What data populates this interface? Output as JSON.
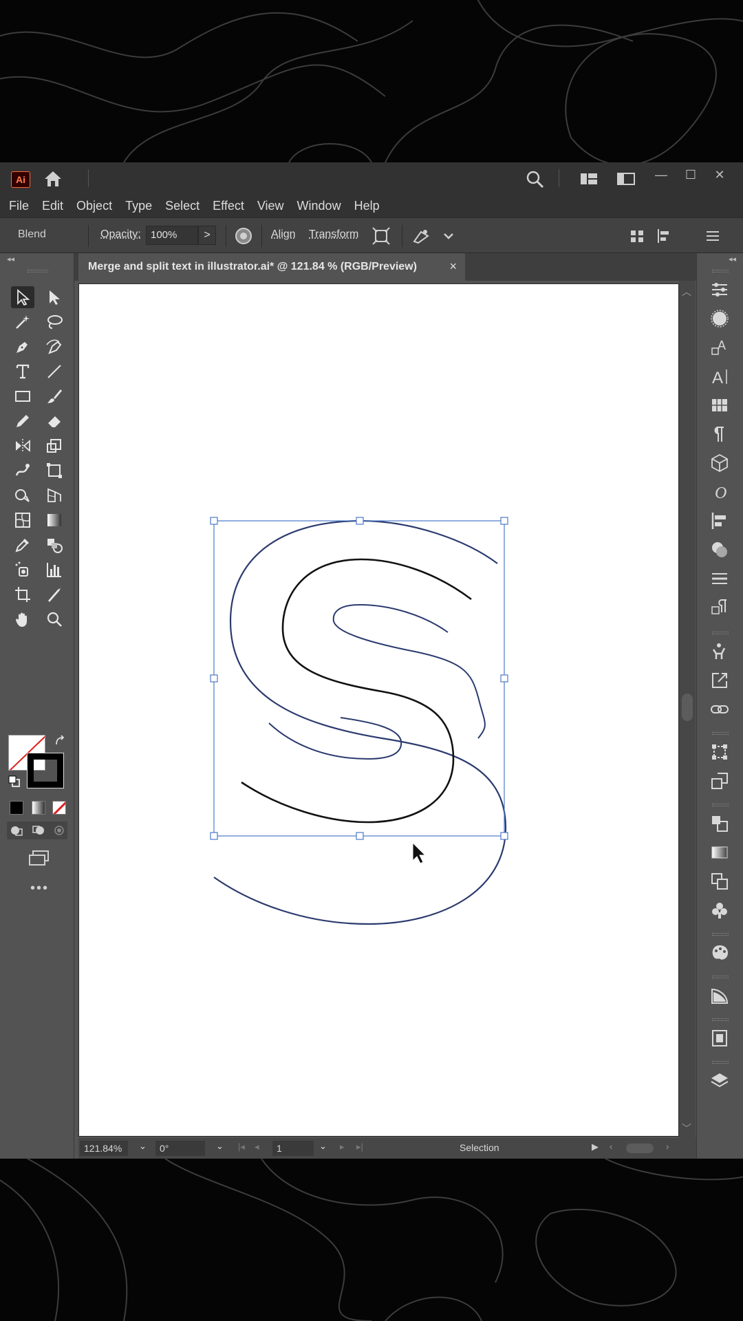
{
  "app": {
    "logo_text": "Ai",
    "document_tab_title": "Merge and split text in illustrator.ai* @ 121.84 % (RGB/Preview)",
    "close_glyph": "×"
  },
  "window_controls": {
    "minimize": "—",
    "maximize": "☐",
    "close": "✕"
  },
  "menu": [
    "File",
    "Edit",
    "Object",
    "Type",
    "Select",
    "Effect",
    "View",
    "Window",
    "Help"
  ],
  "control_bar": {
    "selection_type": "Blend",
    "opacity_label": "Opacity:",
    "opacity_value": "100%",
    "more_arrow": ">",
    "align_label": "Align",
    "transform_label": "Transform"
  },
  "status_bar": {
    "zoom": "121.84%",
    "rotation": "0°",
    "artboard": "1",
    "mode": "Selection"
  },
  "colors": {
    "ui_dark": "#323232",
    "panel": "#535353",
    "selection_blue": "#4a78c8",
    "path_navy": "#2b3a6e",
    "app_orange": "#ff7f50"
  },
  "icons": {
    "left_tools": [
      "selection-tool-icon",
      "direct-selection-tool-icon",
      "magic-wand-icon",
      "lasso-icon",
      "pen-tool-icon",
      "curvature-tool-icon",
      "type-tool-icon",
      "line-segment-icon",
      "rectangle-tool-icon",
      "paintbrush-icon",
      "pencil-icon",
      "eraser-icon",
      "reflect-icon",
      "scale-icon",
      "warp-icon",
      "free-transform-icon",
      "shape-builder-icon",
      "perspective-grid-icon",
      "mesh-icon",
      "gradient-icon",
      "eyedropper-icon",
      "blend-icon",
      "symbol-sprayer-icon",
      "column-graph-icon",
      "artboard-icon",
      "slice-icon",
      "hand-icon",
      "zoom-icon"
    ],
    "right_panels": [
      "properties-icon",
      "appearance-icon",
      "character-styles-icon",
      "character-icon",
      "glyphs-icon",
      "paragraph-icon",
      "3d-icon",
      "opentype-icon",
      "align-icon",
      "pathfinder-icon",
      "stroke-icon",
      "paragraph-styles-icon",
      "puppet-icon",
      "export-icon",
      "links-icon",
      "transform-icon",
      "asset-export-icon",
      "arrange-icon",
      "gradient-panel-icon",
      "transparency-icon",
      "symbols-icon",
      "color-guide-icon",
      "libraries-icon",
      "layers-icon"
    ]
  }
}
